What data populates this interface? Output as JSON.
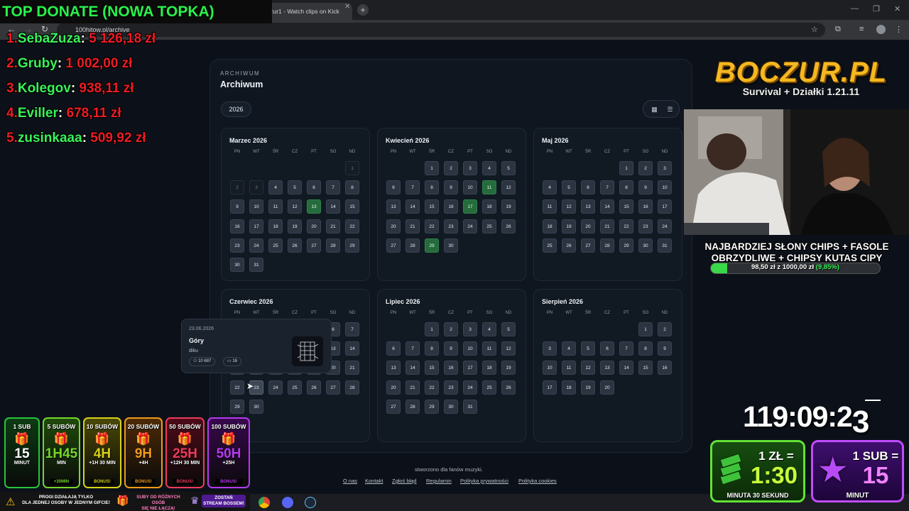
{
  "browser": {
    "tab_title": "boczur1 - Watch clips on Kick",
    "tab_fragment": "czur1 - Watch clips on Kick",
    "url": "100hitow.pl/archive"
  },
  "archive": {
    "eyebrow": "ARCHIWUM",
    "title": "Archiwum",
    "year": "2026",
    "weekdays": [
      "PN",
      "WT",
      "ŚR",
      "CZ",
      "PT",
      "SO",
      "ND"
    ],
    "months": [
      {
        "name": "Marzec 2026",
        "offset": 6,
        "days": 31,
        "dim": [
          1,
          2,
          3
        ],
        "highlight": [
          13
        ]
      },
      {
        "name": "Kwiecień 2026",
        "offset": 2,
        "days": 30,
        "dim": [],
        "highlight": [
          11,
          17,
          29
        ]
      },
      {
        "name": "Maj 2026",
        "offset": 4,
        "days": 31,
        "dim": [],
        "highlight": []
      },
      {
        "name": "Czerwiec 2026",
        "offset": 0,
        "days": 30,
        "dim": [],
        "highlight": []
      },
      {
        "name": "Lipiec 2026",
        "offset": 2,
        "days": 31,
        "dim": [],
        "highlight": []
      },
      {
        "name": "Sierpień 2026",
        "offset": 5,
        "days": 20,
        "dim": [],
        "highlight": []
      }
    ]
  },
  "tooltip": {
    "date": "23.06.2026",
    "title": "Góry",
    "author": "diku",
    "views": "10 687",
    "comments": "16"
  },
  "footer": {
    "credit": "stworzono dla fanów muzyki.",
    "links": [
      "O nas",
      "Kontakt",
      "Zgłoś błąd",
      "Regulamin",
      "Polityka prywatności",
      "Polityka cookies"
    ]
  },
  "overlay": {
    "top_donate": "TOP DONATE (NOWA TOPKA)",
    "donors": [
      {
        "rank": "1.",
        "name": "SebaZuza",
        "amount": "5 126,18 zł"
      },
      {
        "rank": "2.",
        "name": "Gruby",
        "amount": "1 002,00 zł"
      },
      {
        "rank": "3.",
        "name": "Kolegov",
        "amount": "938,11 zł"
      },
      {
        "rank": "4.",
        "name": "Eviller",
        "amount": "678,11 zł"
      },
      {
        "rank": "5.",
        "name": "zusinkaaa",
        "amount": "509,92 zł"
      }
    ],
    "logo": "BOCZUR.PL",
    "logo_sub": "Survival + Działki 1.21.11",
    "goal_line1": "NAJBARDZIEJ SŁONY CHIPS + FASOLE",
    "goal_line2": "OBRZYDLIWE + CHIPSY KUTAS CIPY",
    "goal_progress_text": "98,50 zł z 1000,00 zł",
    "goal_percent_text": "(9,85%)",
    "goal_fraction": 0.0985,
    "timer_main": "119:09:2",
    "timer_last": "3",
    "sub_cards": [
      {
        "head": "1 SUB",
        "big": "15",
        "small": "MINUT",
        "extra": "",
        "color": "#27c43b",
        "dark": "#0c3b12"
      },
      {
        "head": "5 SUBÓW",
        "big": "1H45",
        "small": "MIN",
        "extra": "+30MIN",
        "color": "#76d62b",
        "dark": "#1f4a0a"
      },
      {
        "head": "10 SUBÓW",
        "big": "4H",
        "small": "+1H 30 MIN",
        "extra": "BONUS!",
        "color": "#d8d21a",
        "dark": "#4a4806"
      },
      {
        "head": "20 SUBÓW",
        "big": "9H",
        "small": "+4H",
        "extra": "BONUS!",
        "color": "#f09a1a",
        "dark": "#4d2a05"
      },
      {
        "head": "50 SUBÓW",
        "big": "25H",
        "small": "+12H 30 MIN",
        "extra": "BONUS!",
        "color": "#ef3a5d",
        "dark": "#4d0a18"
      },
      {
        "head": "100 SUBÓW",
        "big": "50H",
        "small": "+25H",
        "extra": "BONUS!",
        "color": "#b63af0",
        "dark": "#37084d"
      }
    ],
    "strip1": "PROGI DZIAŁAJĄ TYLKO\nDLA JEDNEJ OSOBY W JEDNYM GIFCIE!",
    "strip2": "SUBY OD RÓŻNYCH OSÓB\nSIĘ NIE ŁĄCZĄ!",
    "strip3": "ZOSTAŃ\nSTREAM BOSSEM!",
    "rate1_head": "1 ZŁ =",
    "rate1_big": "1:30",
    "rate1_foot": "MINUTA 30 SEKUND",
    "rate2_head": "1 SUB =",
    "rate2_big": "15",
    "rate2_foot": "MINUT"
  }
}
